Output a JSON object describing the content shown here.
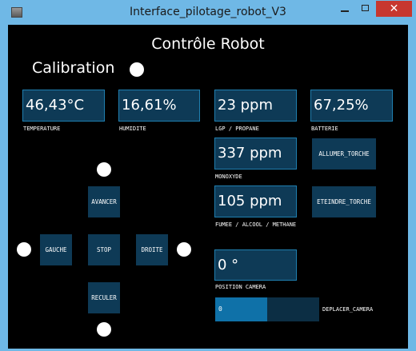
{
  "window": {
    "title": "Interface_pilotage_robot_V3",
    "close_glyph": "✕"
  },
  "header": {
    "title": "Contrôle Robot"
  },
  "calibration": {
    "label": "Calibration"
  },
  "sensors": {
    "temperature": {
      "value": "46,43°C",
      "label": "TEMPERATURE"
    },
    "humidity": {
      "value": "16,61%",
      "label": "HUMIDITE"
    },
    "lgp": {
      "value": "23 ppm",
      "label": "LGP / PROPANE"
    },
    "battery": {
      "value": "67,25%",
      "label": "BATTERIE"
    },
    "monoxide": {
      "value": "337 ppm",
      "label": "MONOXYDE"
    },
    "smoke": {
      "value": "105 ppm",
      "label": "FUMEE / ALCOOL / METHANE"
    },
    "camera": {
      "value": "0 °",
      "label": "POSITION CAMERA"
    }
  },
  "controls": {
    "forward": "AVANCER",
    "left": "GAUCHE",
    "stop": "STOP",
    "right": "DROITE",
    "back": "RECULER",
    "torch_on": "ALLUMER_TORCHE",
    "torch_off": "ETEINDRE_TORCHE"
  },
  "camera_slider": {
    "value": "0",
    "label": "DEPLACER_CAMERA",
    "fill_fraction": 0.5
  },
  "colors": {
    "panel": "#0e3a56",
    "panel_border": "#1f7fb0",
    "slider_fill": "#0f71a8",
    "background": "#000000",
    "frame": "#6fb8e6"
  }
}
